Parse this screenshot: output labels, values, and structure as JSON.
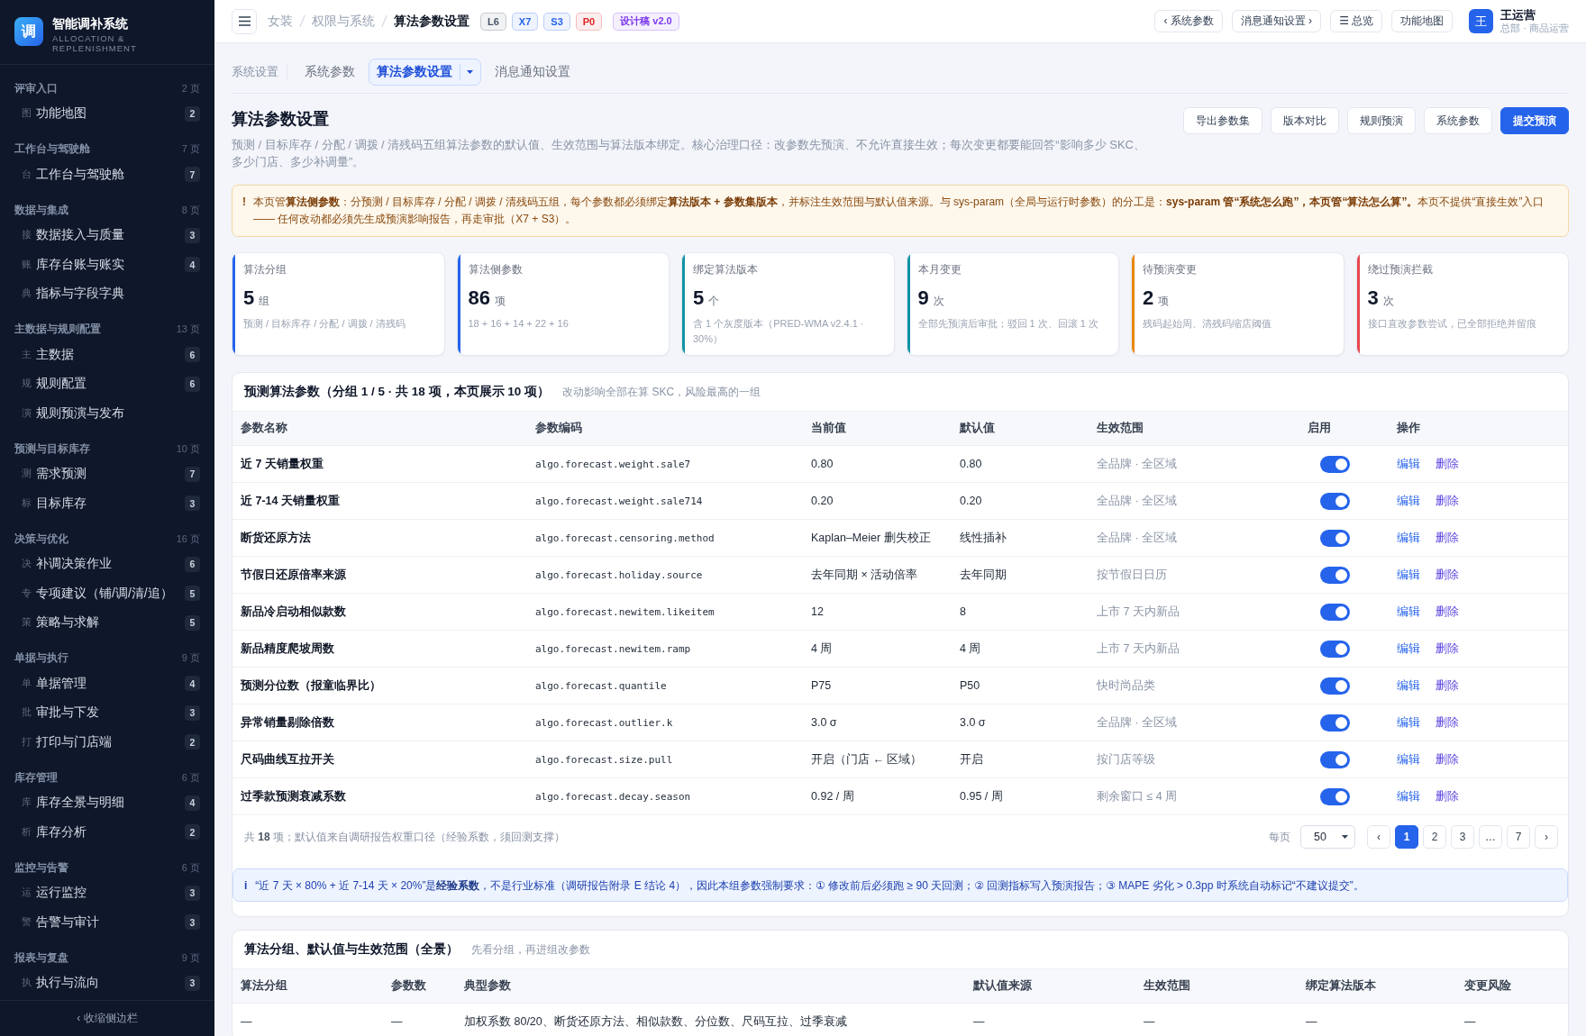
{
  "sidebar": {
    "brand": {
      "mark": "调",
      "title": "智能调补系统",
      "subtitle": "ALLOCATION & REPLENISHMENT"
    },
    "groups": [
      {
        "label": "评审入口",
        "count": "2 页",
        "items": [
          {
            "icon": "图",
            "label": "功能地图",
            "badge": "2",
            "selected": false
          }
        ]
      },
      {
        "label": "工作台与驾驶舱",
        "count": "7 页",
        "items": [
          {
            "icon": "台",
            "label": "工作台与驾驶舱",
            "badge": "7",
            "selected": false
          }
        ]
      },
      {
        "label": "数据与集成",
        "count": "8 页",
        "items": [
          {
            "icon": "接",
            "label": "数据接入与质量",
            "badge": "3",
            "selected": false
          },
          {
            "icon": "账",
            "label": "库存台账与账实",
            "badge": "4",
            "selected": false
          },
          {
            "icon": "典",
            "label": "指标与字段字典",
            "selected": false
          }
        ]
      },
      {
        "label": "主数据与规则配置",
        "count": "13 页",
        "items": [
          {
            "icon": "主",
            "label": "主数据",
            "badge": "6",
            "selected": false
          },
          {
            "icon": "规",
            "label": "规则配置",
            "badge": "6",
            "selected": false
          },
          {
            "icon": "演",
            "label": "规则预演与发布",
            "selected": false
          }
        ]
      },
      {
        "label": "预测与目标库存",
        "count": "10 页",
        "items": [
          {
            "icon": "测",
            "label": "需求预测",
            "badge": "7",
            "selected": false
          },
          {
            "icon": "标",
            "label": "目标库存",
            "badge": "3",
            "selected": false
          }
        ]
      },
      {
        "label": "决策与优化",
        "count": "16 页",
        "items": [
          {
            "icon": "决",
            "label": "补调决策作业",
            "badge": "6",
            "selected": false
          },
          {
            "icon": "专",
            "label": "专项建议（铺/调/清/追）",
            "badge": "5",
            "selected": false
          },
          {
            "icon": "策",
            "label": "策略与求解",
            "badge": "5",
            "selected": false
          }
        ]
      },
      {
        "label": "单据与执行",
        "count": "9 页",
        "items": [
          {
            "icon": "单",
            "label": "单据管理",
            "badge": "4",
            "selected": false
          },
          {
            "icon": "批",
            "label": "审批与下发",
            "badge": "3",
            "selected": false
          },
          {
            "icon": "打",
            "label": "打印与门店端",
            "badge": "2",
            "selected": false
          }
        ]
      },
      {
        "label": "库存管理",
        "count": "6 页",
        "items": [
          {
            "icon": "库",
            "label": "库存全景与明细",
            "badge": "4",
            "selected": false
          },
          {
            "icon": "析",
            "label": "库存分析",
            "badge": "2",
            "selected": false
          }
        ]
      },
      {
        "label": "监控与告警",
        "count": "6 页",
        "items": [
          {
            "icon": "运",
            "label": "运行监控",
            "badge": "3",
            "selected": false
          },
          {
            "icon": "警",
            "label": "告警与审计",
            "badge": "3",
            "selected": false
          }
        ]
      },
      {
        "label": "报表与复盘",
        "count": "9 页",
        "items": [
          {
            "icon": "执",
            "label": "执行与流向",
            "badge": "3",
            "selected": false
          }
        ]
      }
    ],
    "collapse_label": "‹ 收缩侧边栏"
  },
  "topbar": {
    "breadcrumb": [
      {
        "label": "女装",
        "current": false
      },
      {
        "label": "权限与系统",
        "current": false
      },
      {
        "label": "算法参数设置",
        "current": true
      }
    ],
    "tags": [
      {
        "label": "L6",
        "color": "#475569"
      },
      {
        "label": "X7",
        "color": "#2563eb"
      },
      {
        "label": "S3",
        "color": "#2563eb"
      },
      {
        "label": "P0",
        "color": "#dc2626"
      },
      {
        "label": "设计稿 v2.0",
        "color": "#7c3aed"
      }
    ],
    "buttons": [
      {
        "label": "‹ 系统参数"
      },
      {
        "label": "消息通知设置 ›"
      },
      {
        "label": "☰ 总览"
      },
      {
        "label": "功能地图"
      }
    ],
    "user": {
      "avatar": "王",
      "name": "王运营",
      "role": "总部 · 商品运营"
    }
  },
  "subnav": {
    "section": "系统设置",
    "tabs": [
      {
        "label": "系统参数",
        "selected": false,
        "has_menu": false
      },
      {
        "label": "算法参数设置",
        "selected": true,
        "has_menu": true
      },
      {
        "label": "消息通知设置",
        "selected": false,
        "has_menu": false
      }
    ]
  },
  "page_header": {
    "title": "算法参数设置",
    "description": "预测 / 目标库存 / 分配 / 调拨 / 清残码五组算法参数的默认值、生效范围与算法版本绑定。核心治理口径：改参数先预演、不允许直接生效；每次变更都要能回答“影响多少 SKC、多少门店、多少补调量”。",
    "actions": [
      {
        "label": "导出参数集",
        "kind": "default"
      },
      {
        "label": "版本对比",
        "kind": "default"
      },
      {
        "label": "规则预演",
        "kind": "default"
      },
      {
        "label": "系统参数",
        "kind": "default"
      },
      {
        "label": "提交预演",
        "kind": "primary"
      }
    ]
  },
  "alert": {
    "icon": "!",
    "text": "本页管**算法侧参数**：分预测 / 目标库存 / 分配 / 调拨 / 清残码五组，每个参数都必须绑定**算法版本 + 参数集版本**，并标注生效范围与默认值来源。与 sys-param（全局与运行时参数）的分工是：**sys-param 管“系统怎么跑”，本页管“算法怎么算”。**本页不提供“直接生效”入口 —— 任何改动都必须先生成预演影响报告，再走审批（X7 + S3）。"
  },
  "stats": [
    {
      "label": "算法分组",
      "value": "5",
      "unit": "组",
      "note": "预测 / 目标库存 / 分配 / 调拨 / 清残码",
      "color": "#2563eb"
    },
    {
      "label": "算法侧参数",
      "value": "86",
      "unit": "项",
      "note": "18 + 16 + 14 + 22 + 16",
      "color": "#2563eb"
    },
    {
      "label": "绑定算法版本",
      "value": "5",
      "unit": "个",
      "note": "含 1 个灰度版本（PRED-WMA v2.4.1 · 30%）",
      "color": "#0e93a5"
    },
    {
      "label": "本月变更",
      "value": "9",
      "unit": "次",
      "note": "全部先预演后审批；驳回 1 次、回滚 1 次",
      "color": "#0e93a5"
    },
    {
      "label": "待预演变更",
      "value": "2",
      "unit": "项",
      "note": "残码起始周、清残码缩店阈值",
      "color": "#e8870e"
    },
    {
      "label": "绕过预演拦截",
      "value": "3",
      "unit": "次",
      "note": "接口直改参数尝试，已全部拒绝并留痕",
      "color": "#e5484d"
    }
  ],
  "params_panel": {
    "title": "预测算法参数（分组 1 / 5 · 共 18 项，本页展示 10 项）",
    "subtitle": "改动影响全部在算 SKC，风险最高的一组",
    "columns": [
      "参数名称",
      "参数编码",
      "当前值",
      "默认值",
      "生效范围",
      "启用",
      "操作"
    ],
    "rows": [
      {
        "name": "近 7 天销量权重",
        "code": "algo.forecast.weight.sale7",
        "current": "0.80",
        "default": "0.80",
        "scope": "全品牌 · 全区域",
        "enabled": true,
        "actions": [
          {
            "label": "编辑",
            "kind": "edit"
          },
          {
            "label": "删除",
            "kind": "delete"
          }
        ]
      },
      {
        "name": "近 7-14 天销量权重",
        "code": "algo.forecast.weight.sale714",
        "current": "0.20",
        "default": "0.20",
        "scope": "全品牌 · 全区域",
        "enabled": true,
        "actions": [
          {
            "label": "编辑",
            "kind": "edit"
          },
          {
            "label": "删除",
            "kind": "delete"
          }
        ]
      },
      {
        "name": "断货还原方法",
        "code": "algo.forecast.censoring.method",
        "current": "Kaplan–Meier 删失校正",
        "default": "线性插补",
        "scope": "全品牌 · 全区域",
        "enabled": true,
        "actions": [
          {
            "label": "编辑",
            "kind": "edit"
          },
          {
            "label": "删除",
            "kind": "delete"
          }
        ]
      },
      {
        "name": "节假日还原倍率来源",
        "code": "algo.forecast.holiday.source",
        "current": "去年同期 × 活动倍率",
        "default": "去年同期",
        "scope": "按节假日日历",
        "enabled": true,
        "actions": [
          {
            "label": "编辑",
            "kind": "edit"
          },
          {
            "label": "删除",
            "kind": "delete"
          }
        ]
      },
      {
        "name": "新品冷启动相似款数",
        "code": "algo.forecast.newitem.likeitem",
        "current": "12",
        "default": "8",
        "scope": "上市 7 天内新品",
        "enabled": true,
        "actions": [
          {
            "label": "编辑",
            "kind": "edit"
          },
          {
            "label": "删除",
            "kind": "delete"
          }
        ]
      },
      {
        "name": "新品精度爬坡周数",
        "code": "algo.forecast.newitem.ramp",
        "current": "4 周",
        "default": "4 周",
        "scope": "上市 7 天内新品",
        "enabled": true,
        "actions": [
          {
            "label": "编辑",
            "kind": "edit"
          },
          {
            "label": "删除",
            "kind": "delete"
          }
        ]
      },
      {
        "name": "预测分位数（报童临界比）",
        "code": "algo.forecast.quantile",
        "current": "P75",
        "default": "P50",
        "scope": "快时尚品类",
        "enabled": true,
        "actions": [
          {
            "label": "编辑",
            "kind": "edit"
          },
          {
            "label": "删除",
            "kind": "delete"
          }
        ]
      },
      {
        "name": "异常销量剔除倍数",
        "code": "algo.forecast.outlier.k",
        "current": "3.0 σ",
        "default": "3.0 σ",
        "scope": "全品牌 · 全区域",
        "enabled": true,
        "actions": [
          {
            "label": "编辑",
            "kind": "edit"
          },
          {
            "label": "删除",
            "kind": "delete"
          }
        ]
      },
      {
        "name": "尺码曲线互拉开关",
        "code": "algo.forecast.size.pull",
        "current": "开启（门店 ← 区域）",
        "default": "开启",
        "scope": "按门店等级",
        "enabled": true,
        "actions": [
          {
            "label": "编辑",
            "kind": "edit"
          },
          {
            "label": "删除",
            "kind": "delete"
          }
        ]
      },
      {
        "name": "过季款预测衰减系数",
        "code": "algo.forecast.decay.season",
        "current": "0.92 / 周",
        "default": "0.95 / 周",
        "scope": "剩余窗口 ≤ 4 周",
        "enabled": true,
        "actions": [
          {
            "label": "编辑",
            "kind": "edit"
          },
          {
            "label": "删除",
            "kind": "delete"
          }
        ]
      }
    ],
    "summary": "共 **18** 项；默认值来自调研报告权重口径（经验系数，须回测支撑）",
    "pagination": {
      "per_page_label": "每页",
      "per_page": "50",
      "prev": "‹",
      "next": "›",
      "pages": [
        {
          "label": "1",
          "selected": true
        },
        {
          "label": "2",
          "selected": false
        },
        {
          "label": "3",
          "selected": false
        },
        {
          "label": "…",
          "selected": false
        },
        {
          "label": "7",
          "selected": false
        }
      ]
    },
    "note": {
      "icon": "i",
      "text": "“近 7 天 × 80% + 近 7-14 天 × 20%”是**经验系数**，不是行业标准（调研报告附录 E 结论 4），因此本组参数强制要求：① 修改前后必须跑 ≥ 90 天回测；② 回测指标写入预演报告；③ MAPE 劣化 > 0.3pp 时系统自动标记“不建议提交”。"
    }
  },
  "groups_panel": {
    "title": "算法分组、默认值与生效范围（全景）",
    "subtitle": "先看分组，再进组改参数",
    "columns": [
      "算法分组",
      "参数数",
      "典型参数",
      "默认值来源",
      "生效范围",
      "绑定算法版本",
      "变更风险"
    ],
    "rows": [
      [
        "—",
        "—",
        "加权系数 80/20、断货还原方法、相似款数、分位数、尺码互拉、过季衰减",
        "—",
        "—",
        "—",
        "—"
      ]
    ]
  }
}
